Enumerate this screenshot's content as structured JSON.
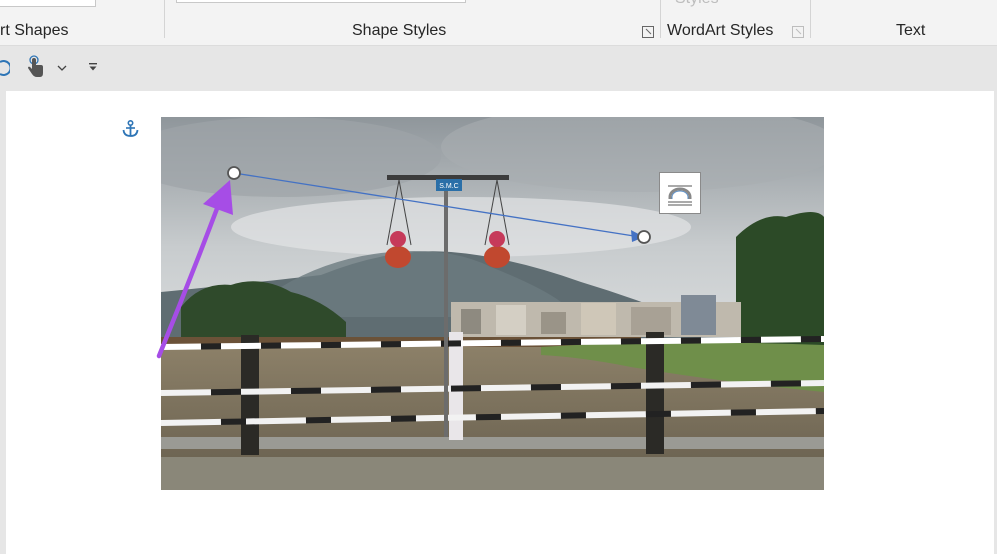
{
  "ribbon": {
    "groups": {
      "insert_shapes_label": "rt Shapes",
      "shape_styles_label": "Shape Styles",
      "wordart_styles_label": "WordArt Styles",
      "text_label": "Text",
      "styles_partial_label": "Styles"
    }
  },
  "quick_access": {
    "icons": [
      "redo-icon",
      "touch-mode-icon",
      "dropdown-chevron-icon",
      "customize-qat-icon"
    ]
  },
  "document": {
    "anchor_icon": "anchor-icon",
    "image": {
      "sign_text": "S.M.C"
    },
    "layout_options_icon": "layout-options-icon"
  },
  "colors": {
    "accent_purple": "#a64de6",
    "connector_blue": "#4472c4",
    "anchor_blue": "#2e75b6"
  }
}
